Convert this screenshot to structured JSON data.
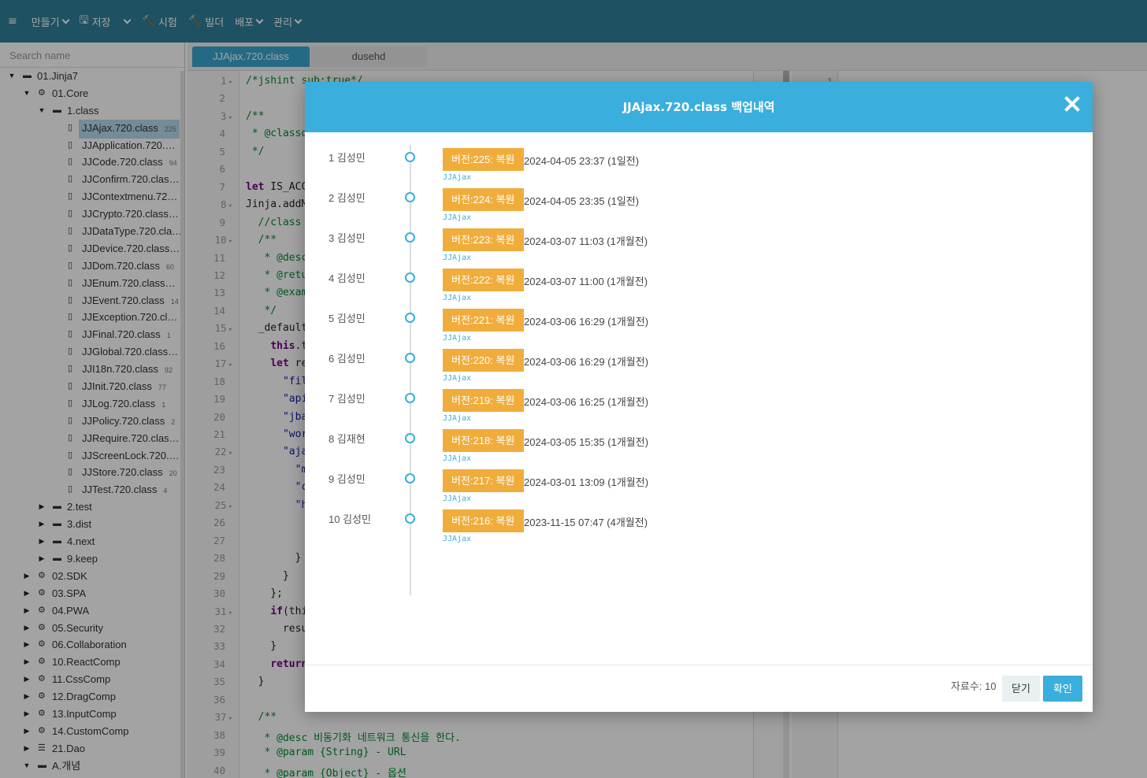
{
  "toolbar": {
    "items": [
      {
        "icon": "≡",
        "label": ""
      },
      {
        "icon": "",
        "label": "만들기"
      },
      {
        "icon": "🖫",
        "label": "저장"
      },
      {
        "icon": "",
        "label": ""
      },
      {
        "icon": "🔨",
        "label": "시험"
      },
      {
        "icon": "🔨",
        "label": "빌더"
      },
      {
        "icon": "",
        "label": "배포"
      },
      {
        "icon": "",
        "label": "관리"
      }
    ]
  },
  "sidebar": {
    "search_placeholder": "Search name",
    "tree": [
      {
        "label": "01.Jinja7",
        "icon": "folder",
        "toggle": "▼",
        "level": 0
      },
      {
        "label": "01.Core",
        "icon": "gear",
        "toggle": "▼",
        "level": 1
      },
      {
        "label": "1.class",
        "icon": "folder",
        "toggle": "▼",
        "level": 2
      },
      {
        "label": "JJAjax.720.class",
        "count": "225",
        "icon": "file",
        "toggle": "",
        "level": 3,
        "selected": true
      },
      {
        "label": "JJApplication.720.…",
        "count": "",
        "icon": "file",
        "toggle": "",
        "level": 3
      },
      {
        "label": "JJCode.720.class",
        "count": "94",
        "icon": "file",
        "toggle": "",
        "level": 3
      },
      {
        "label": "JJConfirm.720.clas…",
        "count": "",
        "icon": "file",
        "toggle": "",
        "level": 3
      },
      {
        "label": "JJContextmenu.72…",
        "count": "",
        "icon": "file",
        "toggle": "",
        "level": 3
      },
      {
        "label": "JJCrypto.720.class…",
        "count": "",
        "icon": "file",
        "toggle": "",
        "level": 3
      },
      {
        "label": "JJDataType.720.cla…",
        "count": "",
        "icon": "file",
        "toggle": "",
        "level": 3
      },
      {
        "label": "JJDevice.720.class…",
        "count": "",
        "icon": "file",
        "toggle": "",
        "level": 3
      },
      {
        "label": "JJDom.720.class",
        "count": "60",
        "icon": "file",
        "toggle": "",
        "level": 3
      },
      {
        "label": "JJEnum.720.class…",
        "count": "",
        "icon": "file",
        "toggle": "",
        "level": 3
      },
      {
        "label": "JJEvent.720.class",
        "count": "14",
        "icon": "file",
        "toggle": "",
        "level": 3
      },
      {
        "label": "JJException.720.cl…",
        "count": "",
        "icon": "file",
        "toggle": "",
        "level": 3
      },
      {
        "label": "JJFinal.720.class",
        "count": "1",
        "icon": "file",
        "toggle": "",
        "level": 3
      },
      {
        "label": "JJGlobal.720.class…",
        "count": "",
        "icon": "file",
        "toggle": "",
        "level": 3
      },
      {
        "label": "JJI18n.720.class",
        "count": "92",
        "icon": "file",
        "toggle": "",
        "level": 3
      },
      {
        "label": "JJInit.720.class",
        "count": "77",
        "icon": "file",
        "toggle": "",
        "level": 3
      },
      {
        "label": "JJLog.720.class",
        "count": "1",
        "icon": "file",
        "toggle": "",
        "level": 3
      },
      {
        "label": "JJPolicy.720.class",
        "count": "2",
        "icon": "file",
        "toggle": "",
        "level": 3
      },
      {
        "label": "JJRequire.720.clas…",
        "count": "",
        "icon": "file",
        "toggle": "",
        "level": 3
      },
      {
        "label": "JJScreenLock.720.…",
        "count": "",
        "icon": "file",
        "toggle": "",
        "level": 3
      },
      {
        "label": "JJStore.720.class",
        "count": "20",
        "icon": "file",
        "toggle": "",
        "level": 3
      },
      {
        "label": "JJTest.720.class",
        "count": "4",
        "icon": "file",
        "toggle": "",
        "level": 3
      },
      {
        "label": "2.test",
        "icon": "folder",
        "toggle": "▶",
        "level": 2
      },
      {
        "label": "3.dist",
        "icon": "folder",
        "toggle": "▶",
        "level": 2
      },
      {
        "label": "4.next",
        "icon": "folder",
        "toggle": "▶",
        "level": 2
      },
      {
        "label": "9.keep",
        "icon": "folder",
        "toggle": "▶",
        "level": 2
      },
      {
        "label": "02.SDK",
        "icon": "gear",
        "toggle": "▶",
        "level": 1
      },
      {
        "label": "03.SPA",
        "icon": "gear",
        "toggle": "▶",
        "level": 1
      },
      {
        "label": "04.PWA",
        "icon": "gear",
        "toggle": "▶",
        "level": 1
      },
      {
        "label": "05.Security",
        "icon": "gear",
        "toggle": "▶",
        "level": 1
      },
      {
        "label": "06.Collaboration",
        "icon": "gear",
        "toggle": "▶",
        "level": 1
      },
      {
        "label": "10.ReactComp",
        "icon": "gears",
        "toggle": "▶",
        "level": 1
      },
      {
        "label": "11.CssComp",
        "icon": "gears",
        "toggle": "▶",
        "level": 1
      },
      {
        "label": "12.DragComp",
        "icon": "gears",
        "toggle": "▶",
        "level": 1
      },
      {
        "label": "13.InputComp",
        "icon": "gears",
        "toggle": "▶",
        "level": 1
      },
      {
        "label": "14.CustomComp",
        "icon": "gears",
        "toggle": "▶",
        "level": 1
      },
      {
        "label": "21.Dao",
        "icon": "db",
        "toggle": "▶",
        "level": 1
      },
      {
        "label": "A.개념",
        "icon": "folder",
        "toggle": "▼",
        "level": 1
      }
    ]
  },
  "editor": {
    "tabs": [
      {
        "label": "JJAjax.720.class",
        "active": true
      },
      {
        "label": "dusehd",
        "active": false
      }
    ],
    "right_line_number": "1",
    "lines": [
      {
        "n": "1",
        "fold": "▾",
        "segs": [
          {
            "t": "/*jshint sub:true*/",
            "c": "com"
          }
        ]
      },
      {
        "n": "2",
        "fold": "",
        "segs": []
      },
      {
        "n": "3",
        "fold": "▾",
        "segs": [
          {
            "t": "/**",
            "c": "com"
          }
        ]
      },
      {
        "n": "4",
        "fold": "",
        "segs": [
          {
            "t": " * @classd",
            "c": "com"
          }
        ]
      },
      {
        "n": "5",
        "fold": "",
        "segs": [
          {
            "t": " */",
            "c": "com"
          }
        ]
      },
      {
        "n": "6",
        "fold": "",
        "segs": []
      },
      {
        "n": "7",
        "fold": "",
        "segs": [
          {
            "t": "let",
            "c": "kw"
          },
          {
            "t": " IS_ACC",
            "c": "def"
          }
        ]
      },
      {
        "n": "8",
        "fold": "▾",
        "segs": [
          {
            "t": "Jinja.addM",
            "c": "def"
          }
        ]
      },
      {
        "n": "9",
        "fold": "",
        "segs": [
          {
            "t": "  //class",
            "c": "com"
          }
        ]
      },
      {
        "n": "10",
        "fold": "▾",
        "segs": [
          {
            "t": "  /**",
            "c": "com"
          }
        ]
      },
      {
        "n": "11",
        "fold": "",
        "segs": [
          {
            "t": "   * @desc",
            "c": "com"
          }
        ]
      },
      {
        "n": "12",
        "fold": "",
        "segs": [
          {
            "t": "   * @retu",
            "c": "com"
          }
        ]
      },
      {
        "n": "13",
        "fold": "",
        "segs": [
          {
            "t": "   * @exam",
            "c": "com"
          }
        ]
      },
      {
        "n": "14",
        "fold": "",
        "segs": [
          {
            "t": "   */",
            "c": "com"
          }
        ]
      },
      {
        "n": "15",
        "fold": "▾",
        "segs": [
          {
            "t": "  _default",
            "c": "def"
          }
        ]
      },
      {
        "n": "16",
        "fold": "",
        "segs": [
          {
            "t": "    ",
            "c": "def"
          },
          {
            "t": "this",
            "c": "kw"
          },
          {
            "t": ".t",
            "c": "def"
          }
        ]
      },
      {
        "n": "17",
        "fold": "▾",
        "segs": [
          {
            "t": "    ",
            "c": "def"
          },
          {
            "t": "let",
            "c": "kw"
          },
          {
            "t": " re",
            "c": "def"
          }
        ]
      },
      {
        "n": "18",
        "fold": "",
        "segs": [
          {
            "t": "      \"fil",
            "c": "str"
          }
        ]
      },
      {
        "n": "19",
        "fold": "",
        "segs": [
          {
            "t": "      \"api",
            "c": "str"
          }
        ]
      },
      {
        "n": "20",
        "fold": "",
        "segs": [
          {
            "t": "      \"jba",
            "c": "str"
          }
        ]
      },
      {
        "n": "21",
        "fold": "",
        "segs": [
          {
            "t": "      \"wor",
            "c": "str"
          }
        ]
      },
      {
        "n": "22",
        "fold": "▾",
        "segs": [
          {
            "t": "      \"aja",
            "c": "str"
          }
        ]
      },
      {
        "n": "23",
        "fold": "",
        "segs": [
          {
            "t": "        \"m",
            "c": "str"
          }
        ]
      },
      {
        "n": "24",
        "fold": "",
        "segs": [
          {
            "t": "        \"c",
            "c": "str"
          }
        ]
      },
      {
        "n": "25",
        "fold": "▾",
        "segs": [
          {
            "t": "        \"h",
            "c": "str"
          }
        ]
      },
      {
        "n": "26",
        "fold": "",
        "segs": []
      },
      {
        "n": "27",
        "fold": "",
        "segs": []
      },
      {
        "n": "28",
        "fold": "",
        "segs": [
          {
            "t": "        }",
            "c": "def"
          }
        ]
      },
      {
        "n": "29",
        "fold": "",
        "segs": [
          {
            "t": "      }",
            "c": "def"
          }
        ]
      },
      {
        "n": "30",
        "fold": "",
        "segs": [
          {
            "t": "    };",
            "c": "def"
          }
        ]
      },
      {
        "n": "31",
        "fold": "▾",
        "segs": [
          {
            "t": "    ",
            "c": "def"
          },
          {
            "t": "if",
            "c": "kw"
          },
          {
            "t": "(thi",
            "c": "def"
          }
        ]
      },
      {
        "n": "32",
        "fold": "",
        "segs": [
          {
            "t": "      resu",
            "c": "def"
          }
        ]
      },
      {
        "n": "33",
        "fold": "",
        "segs": [
          {
            "t": "    }",
            "c": "def"
          }
        ]
      },
      {
        "n": "34",
        "fold": "",
        "segs": [
          {
            "t": "    ",
            "c": "def"
          },
          {
            "t": "return",
            "c": "kw"
          }
        ]
      },
      {
        "n": "35",
        "fold": "",
        "segs": [
          {
            "t": "  }",
            "c": "def"
          }
        ]
      },
      {
        "n": "36",
        "fold": "",
        "segs": []
      },
      {
        "n": "37",
        "fold": "▾",
        "segs": [
          {
            "t": "  /**",
            "c": "com"
          }
        ]
      },
      {
        "n": "38",
        "fold": "",
        "segs": [
          {
            "t": "   * @desc 비동기화 네트워크 통신을 한다.",
            "c": "com"
          }
        ]
      },
      {
        "n": "39",
        "fold": "",
        "segs": [
          {
            "t": "   * @param {String} - URL",
            "c": "com"
          }
        ]
      },
      {
        "n": "40",
        "fold": "",
        "segs": [
          {
            "t": "   * @param {Object} - 옵션",
            "c": "com"
          }
        ]
      }
    ]
  },
  "modal": {
    "title": "JJAjax.720.class 백업내역",
    "entries": [
      {
        "idx": "1",
        "user": "김성민",
        "badge": "버전:225: 복원",
        "datetime": "2024-04-05 23:37 (1일전)",
        "source": "JJAjax"
      },
      {
        "idx": "2",
        "user": "김성민",
        "badge": "버전:224: 복원",
        "datetime": "2024-04-05 23:35 (1일전)",
        "source": "JJAjax"
      },
      {
        "idx": "3",
        "user": "김성민",
        "badge": "버전:223: 복원",
        "datetime": "2024-03-07 11:03 (1개월전)",
        "source": "JJAjax"
      },
      {
        "idx": "4",
        "user": "김성민",
        "badge": "버전:222: 복원",
        "datetime": "2024-03-07 11:00 (1개월전)",
        "source": "JJAjax"
      },
      {
        "idx": "5",
        "user": "김성민",
        "badge": "버전:221: 복원",
        "datetime": "2024-03-06 16:29 (1개월전)",
        "source": "JJAjax"
      },
      {
        "idx": "6",
        "user": "김성민",
        "badge": "버전:220: 복원",
        "datetime": "2024-03-06 16:29 (1개월전)",
        "source": "JJAjax"
      },
      {
        "idx": "7",
        "user": "김성민",
        "badge": "버전:219: 복원",
        "datetime": "2024-03-06 16:25 (1개월전)",
        "source": "JJAjax"
      },
      {
        "idx": "8",
        "user": "김재현",
        "badge": "버전:218: 복원",
        "datetime": "2024-03-05 15:35 (1개월전)",
        "source": "JJAjax"
      },
      {
        "idx": "9",
        "user": "김성민",
        "badge": "버전:217: 복원",
        "datetime": "2024-03-01 13:09 (1개월전)",
        "source": "JJAjax"
      },
      {
        "idx": "10",
        "user": "김성민",
        "badge": "버전:216: 복원",
        "datetime": "2023-11-15 07:47 (4개월전)",
        "source": "JJAjax"
      }
    ],
    "count_text": "자료수: 10",
    "close_label": "닫기",
    "ok_label": "확인"
  }
}
